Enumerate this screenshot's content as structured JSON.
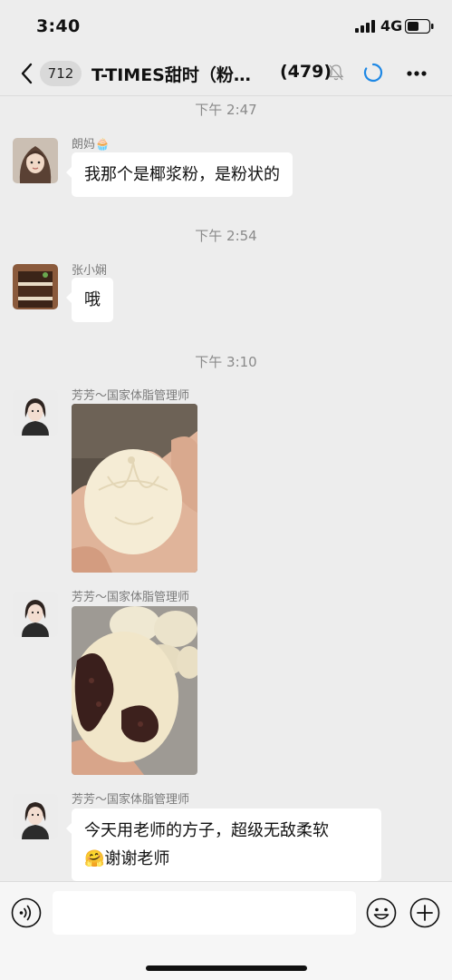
{
  "status_bar": {
    "time": "3:40",
    "network": "4G"
  },
  "header": {
    "unread_count": "712",
    "title": "T-TIMES甜时（粉…",
    "member_count": "(479)"
  },
  "messages": [
    {
      "timestamp": "下午 2:47",
      "sender": "朗妈🧁",
      "text": "我那个是椰浆粉，是粉状的"
    },
    {
      "timestamp": "下午 2:54",
      "sender": "张小娴",
      "text": "哦"
    },
    {
      "timestamp": "下午 3:10",
      "sender": "芳芳～国家体脂管理师",
      "image": "steamed-bun-photo"
    },
    {
      "sender": "芳芳～国家体脂管理师",
      "image": "red-bean-bun-photo"
    },
    {
      "sender": "芳芳～国家体脂管理师",
      "text_line1": "今天用老师的方子，超级无敌柔软",
      "text_line2": "谢谢老师",
      "emoji": "🤗"
    }
  ],
  "input_bar": {
    "placeholder": ""
  },
  "colors": {
    "background": "#ededed",
    "bubble": "#ffffff",
    "accent": "#1e88e5"
  }
}
